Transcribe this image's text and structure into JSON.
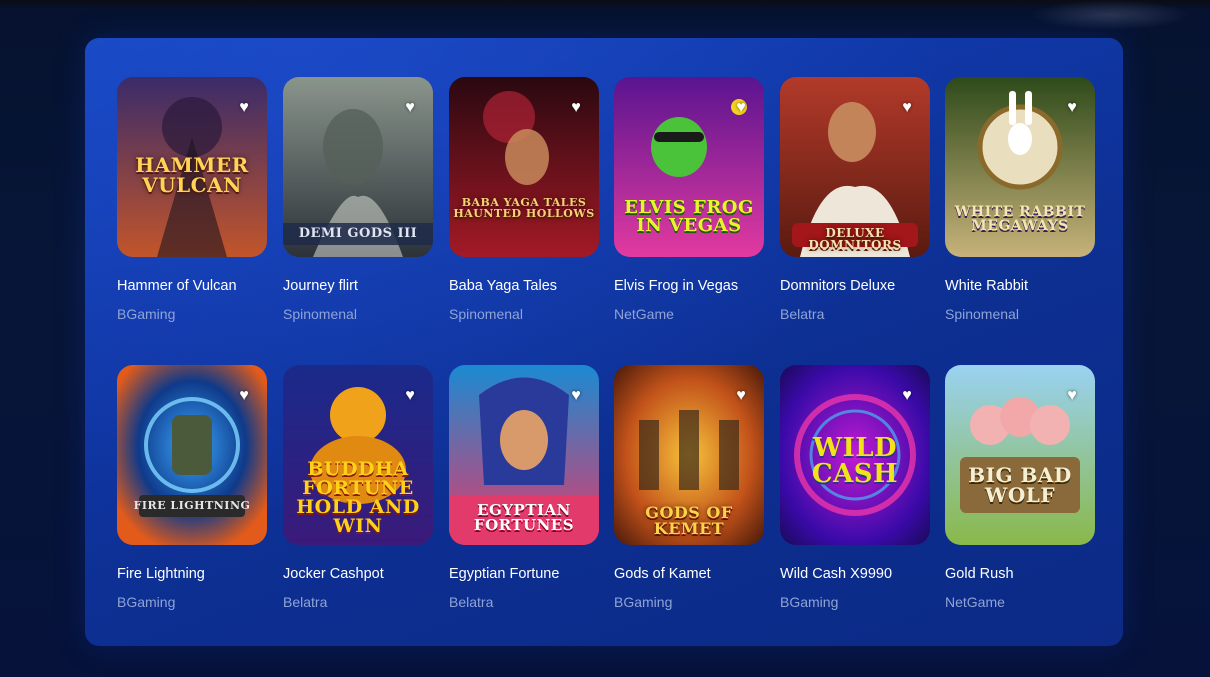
{
  "games": [
    {
      "title": "Hammer of Vulcan",
      "provider": "BGaming",
      "art_text": "HAMMER VULCAN",
      "colors": [
        "#3a2b6a",
        "#c2552a"
      ]
    },
    {
      "title": "Journey flirt",
      "provider": "Spinomenal",
      "art_text": "DEMI GODS III",
      "colors": [
        "#6f7a73",
        "#2c3238"
      ]
    },
    {
      "title": "Baba Yaga Tales",
      "provider": "Spinomenal",
      "art_text": "BABA YAGA TALES HAUNTED HOLLOWS",
      "colors": [
        "#4a0c14",
        "#a31a26"
      ]
    },
    {
      "title": "Elvis Frog in Vegas",
      "provider": "NetGame",
      "art_text": "ELVIS FROG IN VEGAS",
      "colors": [
        "#6d1aa8",
        "#e23aa0"
      ]
    },
    {
      "title": "Domnitors Deluxe",
      "provider": "Belatra",
      "art_text": "DELUXE DOMNITORS",
      "colors": [
        "#8a2a1e",
        "#e6d6c2"
      ]
    },
    {
      "title": "White Rabbit",
      "provider": "Spinomenal",
      "art_text": "WHITE RABBIT MEGAWAYS",
      "colors": [
        "#6b5a2a",
        "#c7b27a"
      ]
    },
    {
      "title": "Fire Lightning",
      "provider": "BGaming",
      "art_text": "FIRE LIGHTNING",
      "colors": [
        "#0f3a8a",
        "#e25b1a"
      ]
    },
    {
      "title": "Jocker Cashpot",
      "provider": "Belatra",
      "art_text": "BUDDHA FORTUNE HOLD AND WIN",
      "colors": [
        "#1a2a8a",
        "#f0a21a"
      ]
    },
    {
      "title": "Egyptian Fortune",
      "provider": "Belatra",
      "art_text": "EGYPTIAN FORTUNES",
      "colors": [
        "#1a5ea8",
        "#e23a6a"
      ]
    },
    {
      "title": "Gods of Kamet",
      "provider": "BGaming",
      "art_text": "GODS OF KEMET",
      "colors": [
        "#7a2a0a",
        "#f2a01a"
      ]
    },
    {
      "title": "Wild Cash X9990",
      "provider": "BGaming",
      "art_text": "WILD CASH",
      "colors": [
        "#2a0a7a",
        "#c21ad2"
      ]
    },
    {
      "title": "Gold Rush",
      "provider": "NetGame",
      "art_text": "BIG BAD WOLF",
      "colors": [
        "#6aa8d2",
        "#8ab84a"
      ]
    }
  ],
  "favorite_icon": "heart-icon"
}
